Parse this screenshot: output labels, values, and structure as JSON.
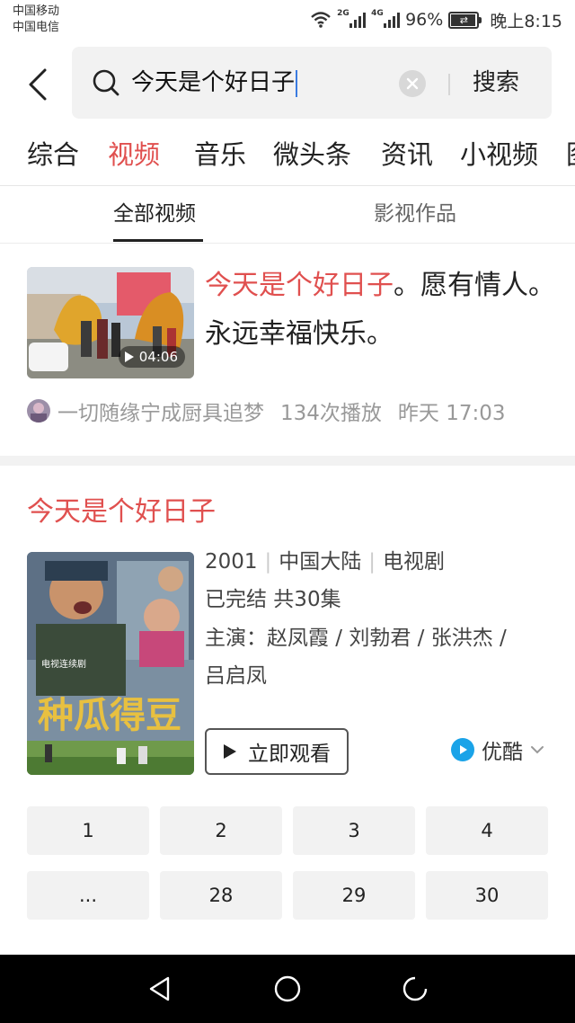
{
  "status_bar": {
    "carrier_1": "中国移动",
    "carrier_2": "中国电信",
    "signal_1_tag": "2G",
    "signal_2_tag": "4G",
    "battery": "96%",
    "time": "晚上8:15"
  },
  "search": {
    "query": "今天是个好日子",
    "search_button": "搜索",
    "icons": [
      "back-arrow-icon",
      "search-icon",
      "clear-icon"
    ]
  },
  "category_tabs": [
    "综合",
    "视频",
    "音乐",
    "微头条",
    "资讯",
    "小视频",
    "图"
  ],
  "active_category": "视频",
  "video_subtabs": [
    "全部视频",
    "影视作品"
  ],
  "active_subtab": "全部视频",
  "video_result": {
    "title_highlight": "今天是个好日子",
    "title_rest": "。愿有情人。永远幸福快乐。",
    "duration": "04:06",
    "author": "一切随缘宁成厨具追梦",
    "plays": "134次播放",
    "time": "昨天 17:03"
  },
  "drama": {
    "title": "今天是个好日子",
    "year": "2001",
    "region": "中国大陆",
    "type": "电视剧",
    "status": "已完结 共30集",
    "cast_line1": "主演：赵凤霞 / 刘勃君 / 张洪杰 /",
    "cast_line2": "吕启凤",
    "watch_button": "立即观看",
    "source": "优酷",
    "episodes": [
      "1",
      "2",
      "3",
      "4",
      "...",
      "28",
      "29",
      "30"
    ]
  },
  "colors": {
    "accent": "#e0504f",
    "tile_bg": "#f2f2f2",
    "youku_blue": "#1aa3e8"
  }
}
